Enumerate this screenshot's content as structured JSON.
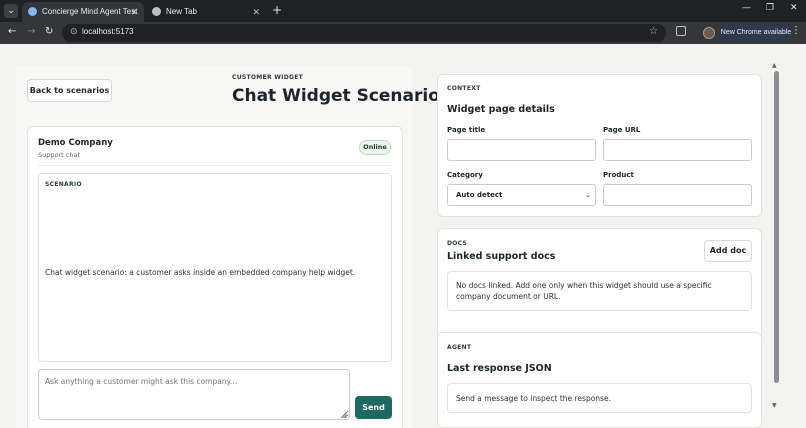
{
  "browser": {
    "tabs": [
      {
        "title": "Concierge Mind Agent Test",
        "active": true
      },
      {
        "title": "New Tab",
        "active": false
      }
    ],
    "url": "localhost:5173",
    "update_chip": "New Chrome available"
  },
  "header": {
    "back_button": "Back to scenarios",
    "eyebrow": "CUSTOMER WIDGET",
    "title": "Chat Widget Scenario"
  },
  "chat": {
    "company_name": "Demo Company",
    "company_subtitle": "Support chat",
    "status_badge": "Online",
    "scenario_label": "SCENARIO",
    "scenario_text": "Chat widget scenario: a customer asks inside an embedded company help widget.",
    "composer_placeholder": "Ask anything a customer might ask this company...",
    "send_label": "Send"
  },
  "context_card": {
    "eyebrow": "CONTEXT",
    "title": "Widget page details",
    "page_title_label": "Page title",
    "page_url_label": "Page URL",
    "category_label": "Category",
    "category_value": "Auto detect",
    "product_label": "Product"
  },
  "docs_card": {
    "eyebrow": "DOCS",
    "title": "Linked support docs",
    "add_button": "Add doc",
    "empty_line1": "No docs linked. Add one only when this widget should use a specific",
    "empty_line2": "company document or URL."
  },
  "agent_card": {
    "eyebrow": "AGENT",
    "title": "Last response JSON",
    "empty_text": "Send a message to inspect the response."
  },
  "colors": {
    "accent": "#1e6a63",
    "online_badge_bg": "#eef6ee",
    "page_bg": "#f3f3f0"
  }
}
